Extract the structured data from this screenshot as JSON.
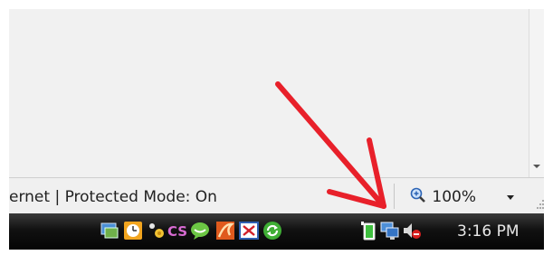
{
  "statusbar": {
    "zone_text": "ernet | Protected Mode: On",
    "zoom_text": "100%"
  },
  "taskbar": {
    "clock": "3:16 PM",
    "icons": [
      "network-monitor-icon",
      "clock-icon",
      "messenger-icon",
      "cs-icon",
      "chat-bubble-icon",
      "flash-icon",
      "window-error-icon",
      "sync-icon",
      "battery-icon",
      "network-icon",
      "volume-muted-icon"
    ]
  },
  "colors": {
    "annotation_arrow": "#e8202a",
    "taskbar": "#111111",
    "statusbar": "#f0f0f0"
  }
}
